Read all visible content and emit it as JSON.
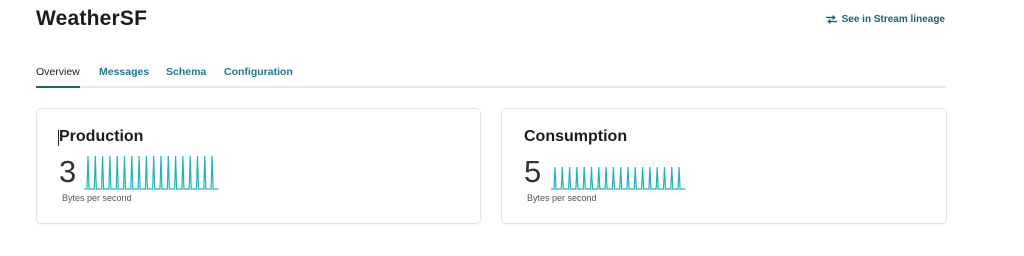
{
  "header": {
    "title": "WeatherSF",
    "lineage_link": "See in Stream lineage"
  },
  "tabs": [
    {
      "label": "Overview",
      "active": true
    },
    {
      "label": "Messages",
      "active": false
    },
    {
      "label": "Schema",
      "active": false
    },
    {
      "label": "Configuration",
      "active": false
    }
  ],
  "cards": {
    "production": {
      "title": "Production",
      "value": "3",
      "unit": "Bytes per second",
      "sparkline_peaks": 18
    },
    "consumption": {
      "title": "Consumption",
      "value": "5",
      "unit": "Bytes per second",
      "sparkline_peaks": 18
    }
  },
  "colors": {
    "sparkline": "#1fb3bf",
    "link": "#1f5f73",
    "tab": "#1d7890",
    "tab_underline": "#1e6478"
  },
  "icons": {
    "lineage": "lineage-icon"
  }
}
